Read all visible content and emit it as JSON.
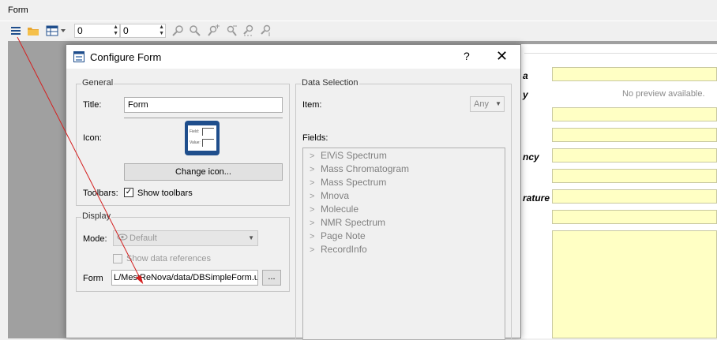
{
  "window": {
    "title": "Form"
  },
  "toolbar": {
    "spin1_value": "0",
    "spin2_value": "0",
    "icons": [
      "menu-icon",
      "open-folder-icon",
      "table-icon",
      "dropdown-arrow-icon",
      "zoom-in-icon",
      "zoom-out-icon",
      "zoom-tool-1-icon",
      "zoom-tool-2-icon",
      "zoom-tool-3-icon",
      "zoom-tool-4-icon"
    ]
  },
  "form_preview": {
    "labels": [
      "a",
      "y",
      "ncy",
      "rature"
    ],
    "no_preview": "No preview available."
  },
  "dialog": {
    "title": "Configure Form",
    "help": "?",
    "close": "✕",
    "general": {
      "group_title": "General",
      "title_label": "Title:",
      "title_value": "Form",
      "icon_label": "Icon:",
      "icon_field_text": "Field:",
      "icon_value_text": "Value:",
      "change_icon_button": "Change icon...",
      "toolbars_label": "Toolbars:",
      "show_toolbars_label": "Show toolbars",
      "show_toolbars_checked": true
    },
    "display": {
      "group_title": "Display",
      "mode_label": "Mode:",
      "mode_value": "Default",
      "show_refs_label": "Show data references",
      "form_label": "Form",
      "form_value": "L/MestReNova/data/DBSimpleForm.ui",
      "browse_button": "..."
    },
    "data_selection": {
      "group_title": "Data Selection",
      "item_label": "Item:",
      "item_value": "Any",
      "fields_label": "Fields:",
      "fields": [
        "ElViS Spectrum",
        "Mass Chromatogram",
        "Mass Spectrum",
        "Mnova",
        "Molecule",
        "NMR Spectrum",
        "Page Note",
        "RecordInfo"
      ]
    }
  }
}
